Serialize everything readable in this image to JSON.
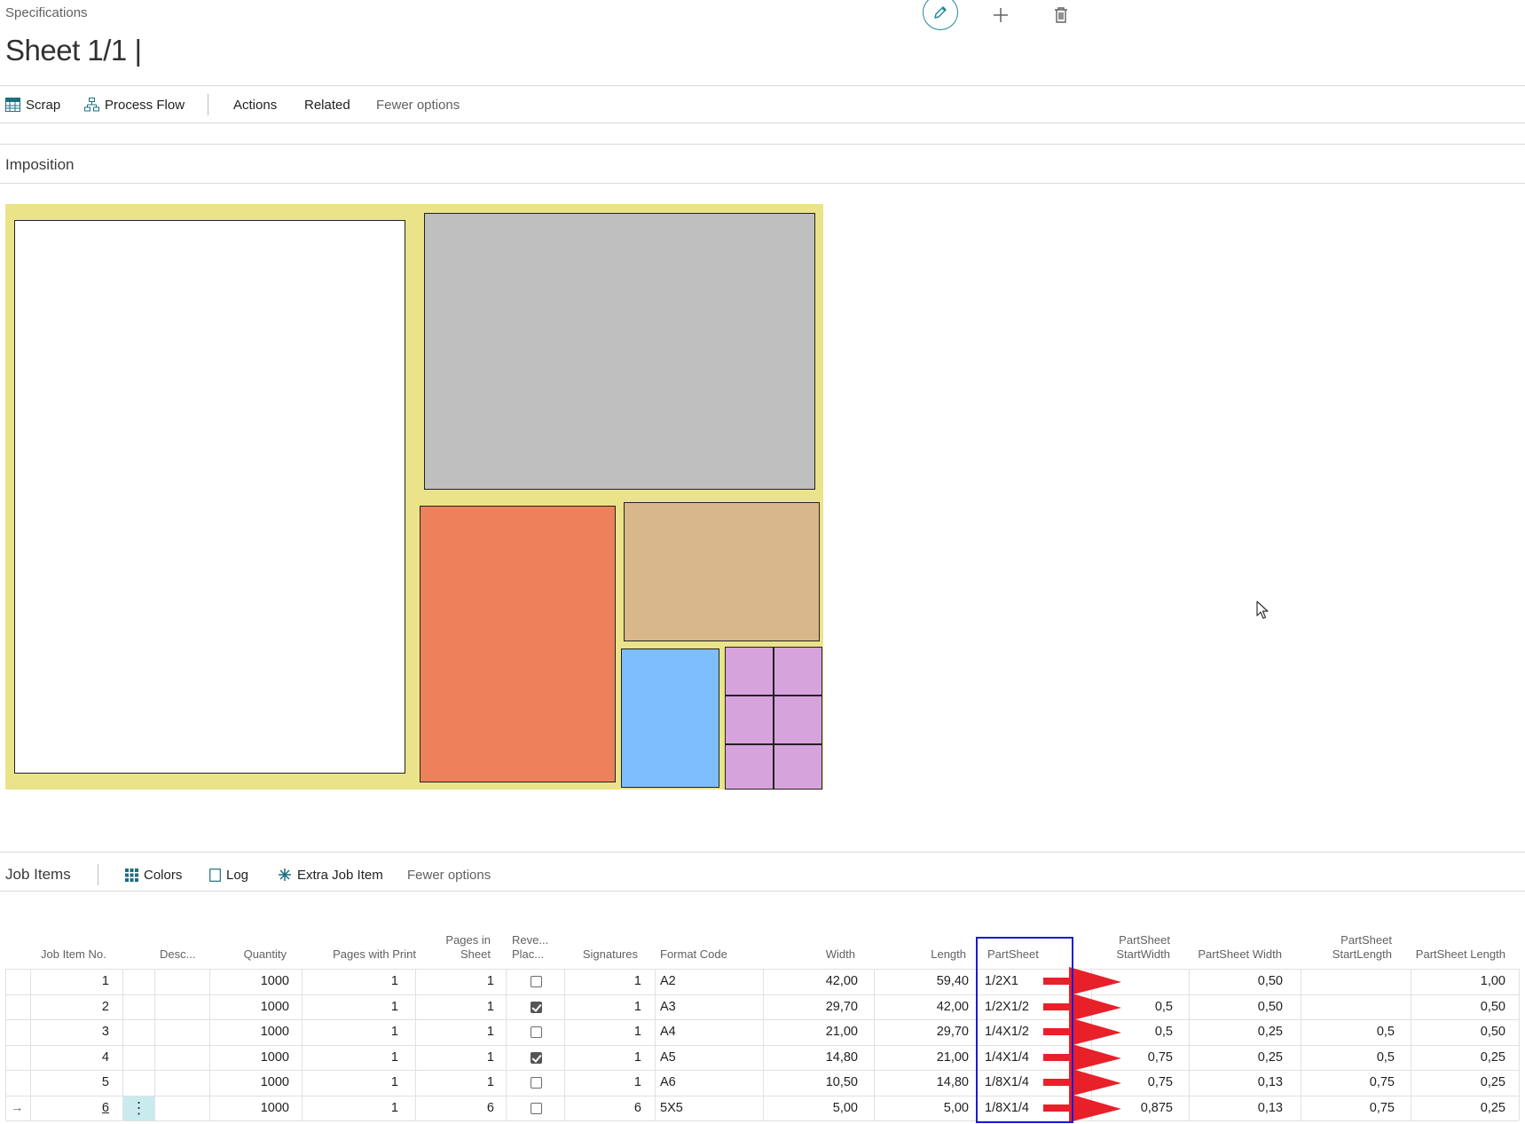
{
  "header": {
    "breadcrumb": "Specifications",
    "title": "Sheet 1/1 |"
  },
  "toolbar": {
    "scrap": "Scrap",
    "process_flow": "Process Flow",
    "actions": "Actions",
    "related": "Related",
    "fewer_options": "Fewer options"
  },
  "imposition": {
    "title": "Imposition",
    "sheet_color": "#ebe38a",
    "part_colors": [
      "#ffffff",
      "#bfbfbf",
      "#ec815b",
      "#d8b88a",
      "#7fbefc",
      "#d6a3dc"
    ]
  },
  "job_items": {
    "title": "Job Items",
    "toolbar": {
      "colors": "Colors",
      "log": "Log",
      "extra_job_item": "Extra Job Item",
      "fewer_options": "Fewer options"
    },
    "columns": {
      "job_item_no": "Job Item No.",
      "desc": "Desc...",
      "quantity": "Quantity",
      "pages_with_print": "Pages with Print",
      "pages_in_sheet_1": "Pages in",
      "pages_in_sheet_2": "Sheet",
      "reverse_1": "Reve...",
      "reverse_2": "Plac...",
      "signatures": "Signatures",
      "format_code": "Format Code",
      "width": "Width",
      "length": "Length",
      "partsheet": "PartSheet",
      "ps_start_width_1": "PartSheet",
      "ps_start_width_2": "StartWidth",
      "ps_width": "PartSheet Width",
      "ps_start_length_1": "PartSheet",
      "ps_start_length_2": "StartLength",
      "ps_length": "PartSheet Length"
    },
    "rows": [
      {
        "no": "1",
        "qty": "1000",
        "pwp": "1",
        "pis": "1",
        "rev": false,
        "sig": "1",
        "fmt": "A2",
        "w": "42,00",
        "l": "59,40",
        "ps": "1/2X1",
        "psw_start": "",
        "psw": "0,50",
        "psl_start": "",
        "psl": "1,00"
      },
      {
        "no": "2",
        "qty": "1000",
        "pwp": "1",
        "pis": "1",
        "rev": true,
        "sig": "1",
        "fmt": "A3",
        "w": "29,70",
        "l": "42,00",
        "ps": "1/2X1/2",
        "psw_start": "0,5",
        "psw": "0,50",
        "psl_start": "",
        "psl": "0,50"
      },
      {
        "no": "3",
        "qty": "1000",
        "pwp": "1",
        "pis": "1",
        "rev": false,
        "sig": "1",
        "fmt": "A4",
        "w": "21,00",
        "l": "29,70",
        "ps": "1/4X1/2",
        "psw_start": "0,5",
        "psw": "0,25",
        "psl_start": "0,5",
        "psl": "0,50"
      },
      {
        "no": "4",
        "qty": "1000",
        "pwp": "1",
        "pis": "1",
        "rev": true,
        "sig": "1",
        "fmt": "A5",
        "w": "14,80",
        "l": "21,00",
        "ps": "1/4X1/4",
        "psw_start": "0,75",
        "psw": "0,25",
        "psl_start": "0,5",
        "psl": "0,25"
      },
      {
        "no": "5",
        "qty": "1000",
        "pwp": "1",
        "pis": "1",
        "rev": false,
        "sig": "1",
        "fmt": "A6",
        "w": "10,50",
        "l": "14,80",
        "ps": "1/8X1/4",
        "psw_start": "0,75",
        "psw": "0,13",
        "psl_start": "0,75",
        "psl": "0,25"
      },
      {
        "no": "6",
        "qty": "1000",
        "pwp": "1",
        "pis": "6",
        "rev": false,
        "sig": "6",
        "fmt": "5X5",
        "w": "5,00",
        "l": "5,00",
        "ps": "1/8X1/4",
        "psw_start": "0,875",
        "psw": "0,13",
        "psl_start": "0,75",
        "psl": "0,25"
      }
    ],
    "colors": {
      "accent": "#1e8a9a",
      "highlight_box": "#1a1ad6",
      "annotation_arrow": "#e8202a",
      "selected_cell": "#c9ebee"
    }
  }
}
